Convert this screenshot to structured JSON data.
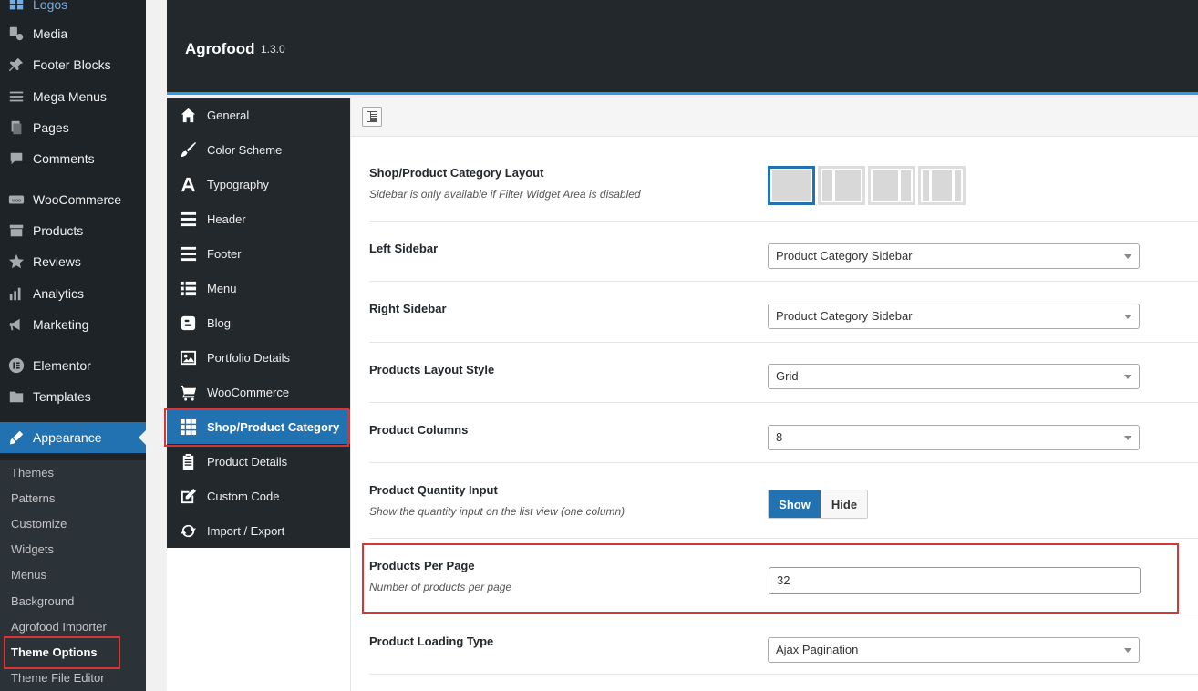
{
  "wp_menu": {
    "items": [
      {
        "label": "Logos",
        "icon": "grid-icon"
      },
      {
        "label": "Media",
        "icon": "media-icon"
      },
      {
        "label": "Footer Blocks",
        "icon": "pin-icon"
      },
      {
        "label": "Mega Menus",
        "icon": "menu-icon"
      },
      {
        "label": "Pages",
        "icon": "pages-icon"
      },
      {
        "label": "Comments",
        "icon": "comment-icon"
      },
      {
        "label": "WooCommerce",
        "icon": "woo-icon"
      },
      {
        "label": "Products",
        "icon": "archive-icon"
      },
      {
        "label": "Reviews",
        "icon": "star-icon"
      },
      {
        "label": "Analytics",
        "icon": "chart-icon"
      },
      {
        "label": "Marketing",
        "icon": "megaphone-icon"
      },
      {
        "label": "Elementor",
        "icon": "elementor-icon"
      },
      {
        "label": "Templates",
        "icon": "folder-icon"
      },
      {
        "label": "Appearance",
        "icon": "brush-icon"
      }
    ],
    "submenu": [
      "Themes",
      "Patterns",
      "Customize",
      "Widgets",
      "Menus",
      "Background",
      "Agrofood Importer",
      "Theme Options",
      "Theme File Editor"
    ]
  },
  "theme_options": {
    "title": "Agrofood",
    "version": "1.3.0",
    "nav": [
      {
        "label": "General",
        "icon": "home-icon"
      },
      {
        "label": "Color Scheme",
        "icon": "brush-icon"
      },
      {
        "label": "Typography",
        "icon": "font-icon"
      },
      {
        "label": "Header",
        "icon": "menu-icon"
      },
      {
        "label": "Footer",
        "icon": "menu-icon"
      },
      {
        "label": "Menu",
        "icon": "list-icon"
      },
      {
        "label": "Blog",
        "icon": "blogger-icon"
      },
      {
        "label": "Portfolio Details",
        "icon": "image-icon"
      },
      {
        "label": "WooCommerce",
        "icon": "cart-icon"
      },
      {
        "label": "Shop/Product Category",
        "icon": "grid-icon"
      },
      {
        "label": "Product Details",
        "icon": "clipboard-icon"
      },
      {
        "label": "Custom Code",
        "icon": "edit-icon"
      },
      {
        "label": "Import / Export",
        "icon": "refresh-icon"
      }
    ],
    "fields": {
      "layout": {
        "title": "Shop/Product Category Layout",
        "desc": "Sidebar is only available if Filter Widget Area is disabled"
      },
      "left_sidebar": {
        "title": "Left Sidebar",
        "value": "Product Category Sidebar"
      },
      "right_sidebar": {
        "title": "Right Sidebar",
        "value": "Product Category Sidebar"
      },
      "layout_style": {
        "title": "Products Layout Style",
        "value": "Grid"
      },
      "columns": {
        "title": "Product Columns",
        "value": "8"
      },
      "quantity": {
        "title": "Product Quantity Input",
        "desc": "Show the quantity input on the list view (one column)",
        "on_label": "Show",
        "off_label": "Hide"
      },
      "per_page": {
        "title": "Products Per Page",
        "desc": "Number of products per page",
        "value": "32"
      },
      "loading": {
        "title": "Product Loading Type",
        "value": "Ajax Pagination"
      }
    }
  }
}
